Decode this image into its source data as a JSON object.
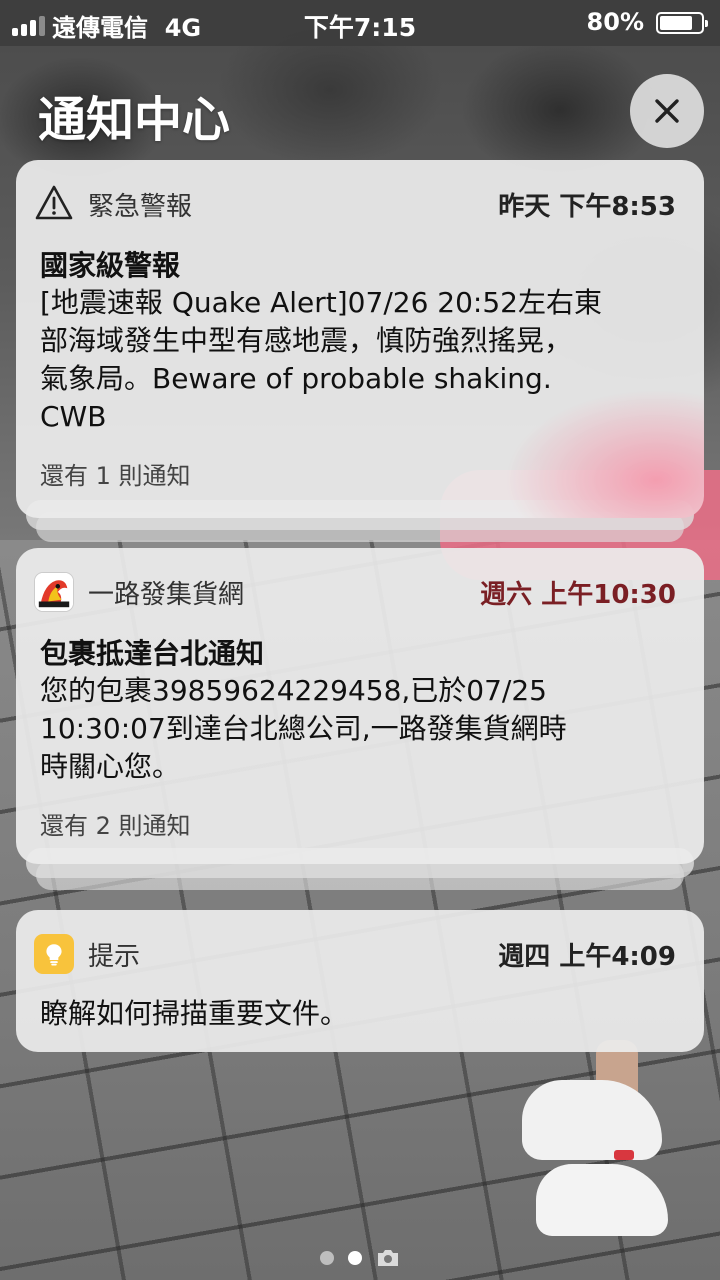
{
  "status_bar": {
    "carrier": "遠傳電信",
    "network": "4G",
    "time": "下午7:15",
    "battery_percent": "80%",
    "battery_level": 0.8
  },
  "header": {
    "title": "通知中心",
    "close_icon": "close-icon"
  },
  "notifications": [
    {
      "app_name": "緊急警報",
      "icon": "warning-triangle-icon",
      "time": "昨天 下午8:53",
      "title": "國家級警報",
      "body_lines": [
        "[地震速報 Quake Alert]07/26 20:52左右東",
        "部海域發生中型有感地震，慎防強烈搖晃，",
        "氣象局。Beware of probable shaking.",
        "CWB"
      ],
      "more": "還有 1 則通知"
    },
    {
      "app_name": "一路發集貨網",
      "icon": "parcel-app-icon",
      "time": "週六 上午10:30",
      "time_color": "#7a1f24",
      "title": "包裹抵達台北通知",
      "body_lines": [
        "您的包裹39859624229458,已於07/25",
        "10:30:07到達台北總公司,一路發集貨網時",
        "時關心您。"
      ],
      "more": "還有 2 則通知"
    },
    {
      "app_name": "提示",
      "icon": "lightbulb-icon",
      "time": "週四 上午4:09",
      "title": "瞭解如何掃描重要文件。"
    }
  ],
  "pager": {
    "pages": 2,
    "active": 1,
    "camera_icon": "camera-icon"
  }
}
